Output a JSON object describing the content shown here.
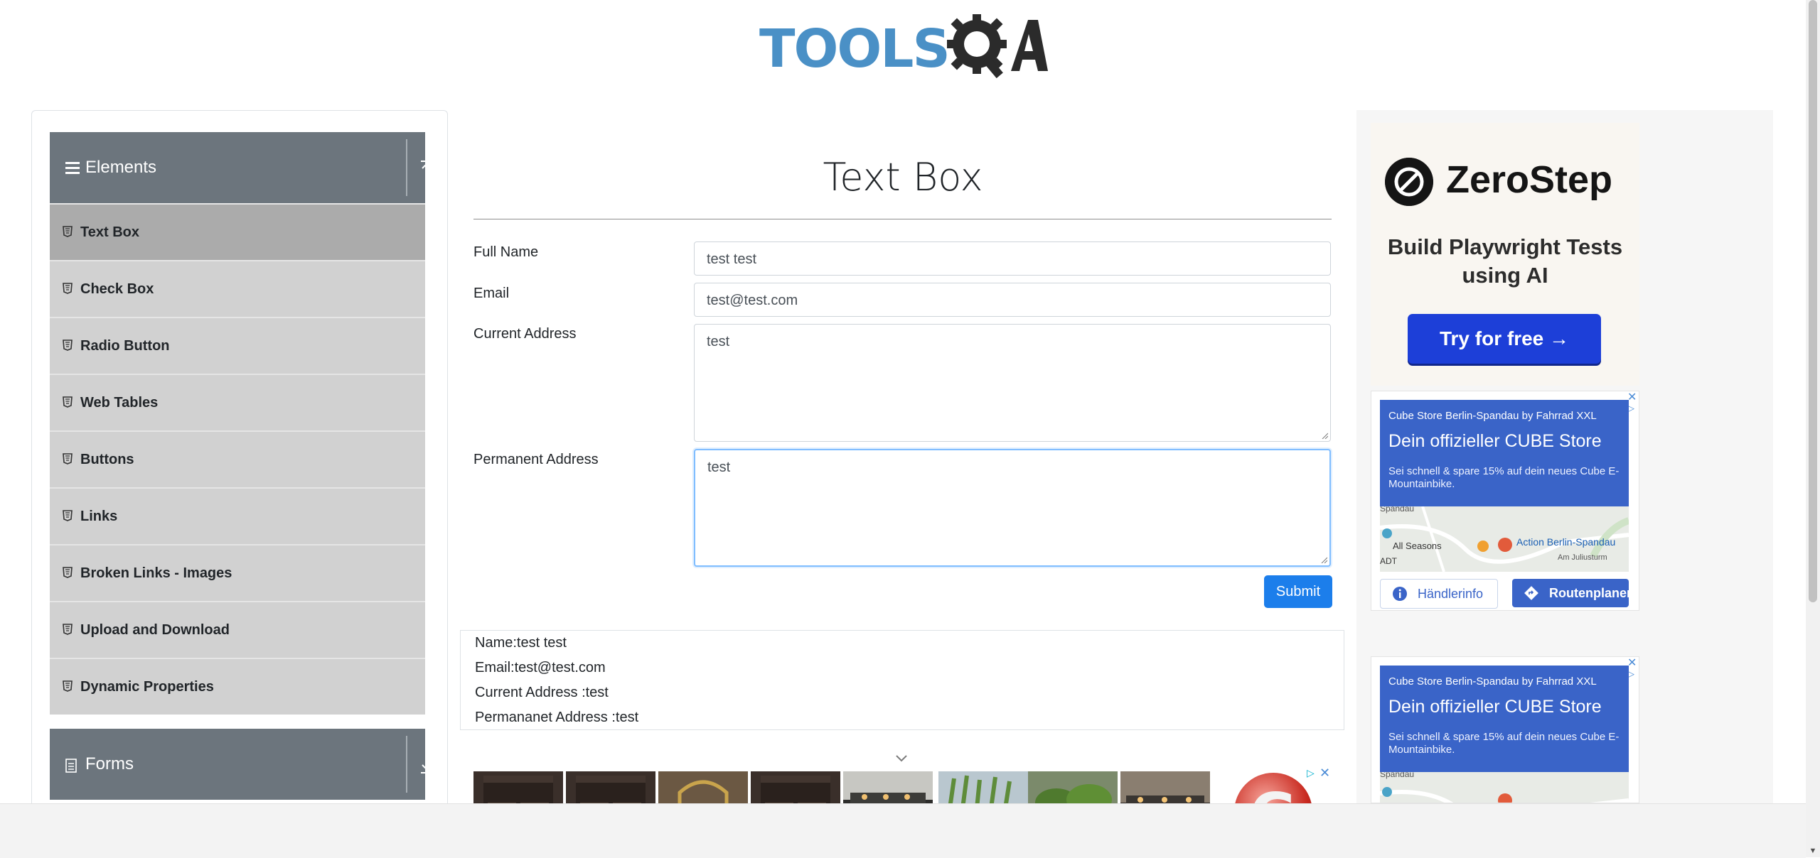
{
  "header": {
    "logo_text_left": "TOOLS",
    "logo_text_right": "QA"
  },
  "sidebar": {
    "groups": [
      {
        "label": "Elements",
        "icon": "hamburger-icon",
        "toggle_icon": "collapse-up-icon"
      },
      {
        "label": "Forms",
        "icon": "document-icon",
        "toggle_icon": "expand-down-icon"
      }
    ],
    "items": [
      {
        "label": "Text Box",
        "active": true
      },
      {
        "label": "Check Box"
      },
      {
        "label": "Radio Button"
      },
      {
        "label": "Web Tables"
      },
      {
        "label": "Buttons"
      },
      {
        "label": "Links"
      },
      {
        "label": "Broken Links - Images"
      },
      {
        "label": "Upload and Download"
      },
      {
        "label": "Dynamic Properties"
      }
    ]
  },
  "main": {
    "title": "Text Box",
    "form": {
      "full_name": {
        "label": "Full Name",
        "value": "test test"
      },
      "email": {
        "label": "Email",
        "value": "test@test.com"
      },
      "current_address": {
        "label": "Current Address",
        "value": "test"
      },
      "permanent_address": {
        "label": "Permanent Address",
        "value": "test"
      },
      "submit_label": "Submit"
    },
    "output": {
      "name": "Name:test test",
      "email": "Email:test@test.com",
      "current_address": "Current Address :test",
      "permanent_address": "Permananet Address :test"
    }
  },
  "ads": {
    "zerostep": {
      "name": "ZeroStep",
      "tagline": "Build Playwright Tests using AI",
      "button": "Try for free →"
    },
    "cube": {
      "brand": "Cube Store Berlin-Spandau by Fahrrad XXL",
      "title": "Dein offizieller CUBE Store",
      "text": "Sei schnell & spare 15% auf dein neues Cube E-Mountainbike.",
      "map_labels": [
        "Spandau",
        "All Seasons",
        "Action Berlin-Spandau",
        "Am Juliusturm",
        "ADT"
      ],
      "button_info": "Händlerinfo",
      "button_route": "Routenplaner"
    },
    "bottom_logo": "G"
  },
  "colors": {
    "primary": "#1c7eeb",
    "sidebar_header": "#6c757d",
    "sidebar_item": "#d1d1d1",
    "sidebar_item_active": "#ababab",
    "logo_blue": "#4a90c6",
    "zerostep_button": "#1d3fd8",
    "cube_blue": "#3a64c8"
  }
}
